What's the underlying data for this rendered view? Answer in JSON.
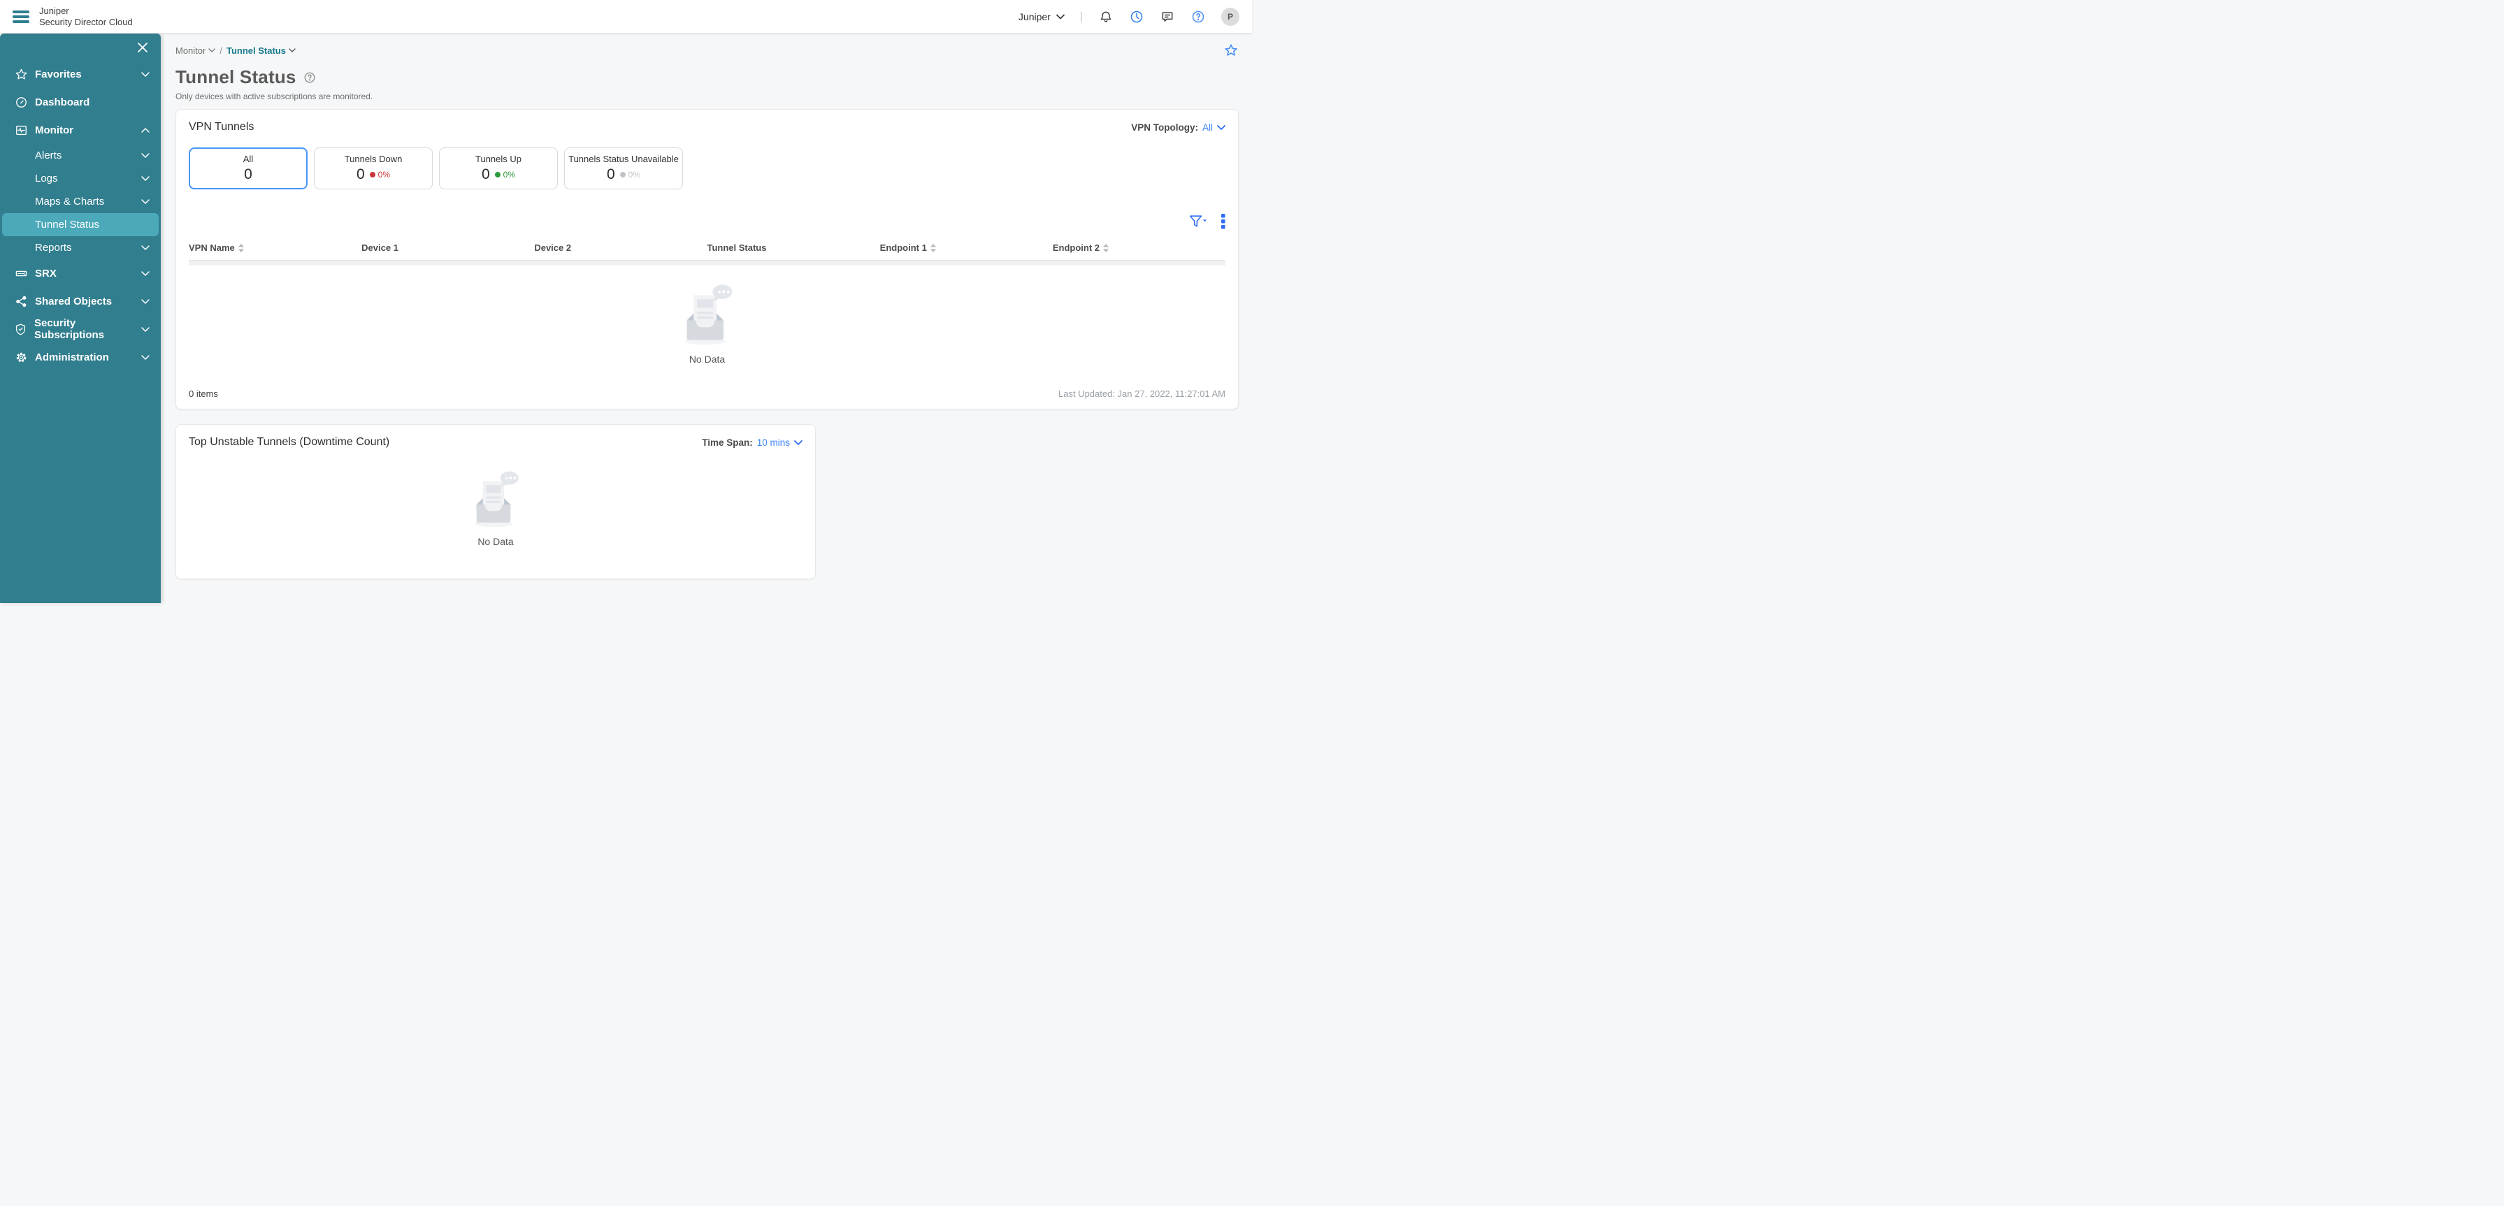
{
  "topbar": {
    "brand": {
      "line1": "Juniper",
      "line2": "Security Director Cloud"
    },
    "tenant": {
      "label": "Juniper"
    },
    "divider": "|",
    "avatar_initial": "P"
  },
  "sidebar": {
    "items": [
      {
        "label": "Favorites",
        "icon": "star-icon",
        "chevron": "down",
        "level": 1
      },
      {
        "label": "Dashboard",
        "icon": "dashboard-gauge-icon",
        "chevron": "",
        "level": 1
      },
      {
        "label": "Monitor",
        "icon": "monitor-icon",
        "chevron": "up",
        "level": 1,
        "expanded": true
      },
      {
        "label": "Alerts",
        "chevron": "down",
        "level": 2
      },
      {
        "label": "Logs",
        "chevron": "down",
        "level": 2
      },
      {
        "label": "Maps & Charts",
        "chevron": "down",
        "level": 2
      },
      {
        "label": "Tunnel Status",
        "chevron": "",
        "level": 2,
        "selected": true
      },
      {
        "label": "Reports",
        "chevron": "down",
        "level": 2
      },
      {
        "label": "SRX",
        "icon": "srx-device-icon",
        "chevron": "down",
        "level": 1
      },
      {
        "label": "Shared Objects",
        "icon": "share-icon",
        "chevron": "down",
        "level": 1
      },
      {
        "label": "Security Subscriptions",
        "icon": "shield-icon",
        "chevron": "down",
        "level": 1
      },
      {
        "label": "Administration",
        "icon": "gear-icon",
        "chevron": "down",
        "level": 1
      }
    ]
  },
  "breadcrumb": {
    "items": [
      "Monitor",
      "Tunnel Status"
    ],
    "separator": "/"
  },
  "page": {
    "title": "Tunnel Status",
    "subtitle": "Only devices with active subscriptions are monitored."
  },
  "vpn_tunnels": {
    "title": "VPN Tunnels",
    "topology": {
      "label": "VPN Topology:",
      "value": "All"
    },
    "tabs": [
      {
        "label": "All",
        "value": "0"
      },
      {
        "label": "Tunnels Down",
        "value": "0",
        "pct": "0%",
        "color": "#c9353b"
      },
      {
        "label": "Tunnels Up",
        "value": "0",
        "pct": "0%",
        "color": "#2e9a3f"
      },
      {
        "label": "Tunnels Status Unavailable",
        "value": "0",
        "pct": "0%",
        "color": "#bfc4c9"
      }
    ],
    "table": {
      "columns": [
        {
          "label": "VPN Name",
          "sortable": true
        },
        {
          "label": "Device 1",
          "sortable": false
        },
        {
          "label": "Device 2",
          "sortable": false
        },
        {
          "label": "Tunnel Status",
          "sortable": false
        },
        {
          "label": "Endpoint 1",
          "sortable": true
        },
        {
          "label": "Endpoint 2",
          "sortable": true
        }
      ],
      "empty_label": "No Data",
      "items_count": "0 items",
      "last_updated": "Last Updated: Jan 27, 2022, 11:27:01 AM"
    }
  },
  "unstable_tunnels": {
    "title": "Top Unstable Tunnels (Downtime Count)",
    "time_span": {
      "label": "Time Span:",
      "value": "10 mins"
    },
    "empty_label": "No Data"
  },
  "colors": {
    "sidebar": "#317e8e",
    "sidebar_selected": "#4ba9ba",
    "topbar_brand_teal": "#2e7f90",
    "accent_blue": "#2f80ed",
    "link_blue": "#3b82f6",
    "selected_tile_border": "#4796f7",
    "down_red": "#c9353b",
    "up_green": "#2e9a3f",
    "unavailable_gray": "#bfc4c9",
    "breadcrumb_active_teal": "#18798c"
  }
}
